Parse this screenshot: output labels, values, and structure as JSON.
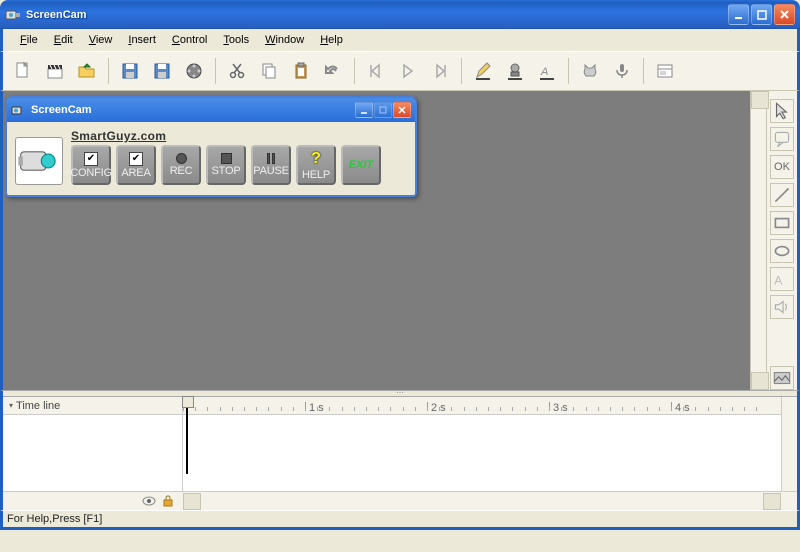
{
  "window": {
    "title": "ScreenCam",
    "minimize": "_",
    "maximize": "□",
    "close": "×"
  },
  "menu": {
    "file": "File",
    "edit": "Edit",
    "view": "View",
    "insert": "Insert",
    "control": "Control",
    "tools": "Tools",
    "window": "Window",
    "help": "Help"
  },
  "float": {
    "title": "ScreenCam",
    "brand": "SmartGuyz.com",
    "config": "CONFIG",
    "area": "AREA",
    "rec": "REC",
    "stop": "STOP",
    "pause": "PAUSE",
    "help": "HELP",
    "exit": "EXIT"
  },
  "rightpanel": {
    "ok": "OK"
  },
  "timeline": {
    "label": "Time line",
    "marks": [
      "1 s",
      "2 s",
      "3 s",
      "4 s"
    ]
  },
  "statusbar": {
    "text": "For Help,Press [F1]"
  }
}
